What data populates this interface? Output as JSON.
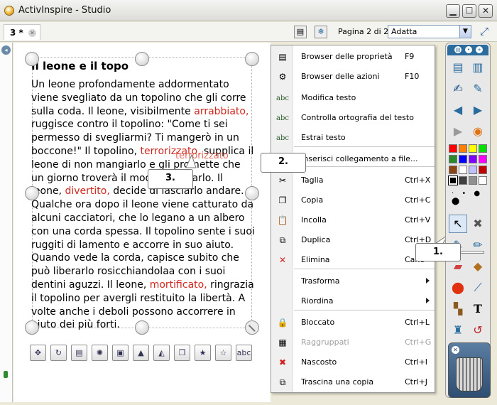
{
  "window": {
    "title": "ActivInspire - Studio"
  },
  "tabs": [
    {
      "label": "3 *"
    }
  ],
  "toolbar": {
    "page_label": "Pagina 2 di 2",
    "zoom_value": "Adatta"
  },
  "flipchart": {
    "title": "Il leone e il topo",
    "story": [
      {
        "text": "Un leone profondamente addormentato viene svegliato da un topolino che gli corre sulla coda. Il leone, visibilmente ",
        "color": ""
      },
      {
        "text": "arrabbiato,",
        "color": "red"
      },
      {
        "text": " ruggisce contro il topolino: \"Come ti sei permesso di svegliarmi? Ti mangerò in un boccone!\" Il topolino, ",
        "color": ""
      },
      {
        "text": "terrorizzato,",
        "color": "red"
      },
      {
        "text": " supplica il leone di non mangiarlo e gli promette che un giorno troverà il modo di aiutarlo. Il leone, ",
        "color": ""
      },
      {
        "text": "divertito,",
        "color": "red"
      },
      {
        "text": " decide di lasciarlo andare. Qualche ora dopo il leone viene catturato da alcuni cacciatori, che lo legano a un albero con una corda spessa. Il topolino sente i suoi ruggiti di lamento e accorre in suo aiuto. Quando vede la corda, capisce subito che può liberarlo rosicchiandolaa con i suoi dentini aguzzi. Il leone, ",
        "color": ""
      },
      {
        "text": "mortificato,",
        "color": "red"
      },
      {
        "text": " ringrazia il topolino per avergli restituito la libertà. A volte anche i deboli possono accorrere in aiuto dei più forti.",
        "color": ""
      }
    ],
    "drag_ghost_text": "terrorizzato"
  },
  "callouts": {
    "one": "1.",
    "two": "2.",
    "three": "3."
  },
  "context_menu": {
    "items": [
      {
        "label": "Browser delle proprietà",
        "shortcut": "F9",
        "icon": "properties-browser-icon",
        "glyph": "▤",
        "disabled": false
      },
      {
        "label": "Browser delle azioni",
        "shortcut": "F10",
        "icon": "actions-browser-icon",
        "glyph": "⚙",
        "disabled": false
      },
      {
        "label": "Modifica testo",
        "shortcut": "",
        "icon": "edit-text-icon",
        "glyph": "abc",
        "disabled": false
      },
      {
        "label": "Controlla ortografia del testo",
        "shortcut": "",
        "icon": "spellcheck-icon",
        "glyph": "abc",
        "disabled": false
      },
      {
        "label": "Estrai testo",
        "shortcut": "",
        "icon": "extract-text-icon",
        "glyph": "abc",
        "disabled": false
      },
      {
        "label": "Inserisci collegamento a file...",
        "shortcut": "",
        "icon": "insert-link-icon",
        "glyph": "🔗",
        "disabled": false
      },
      {
        "label": "Taglia",
        "shortcut": "Ctrl+X",
        "icon": "cut-icon",
        "glyph": "✂",
        "disabled": false
      },
      {
        "label": "Copia",
        "shortcut": "Ctrl+C",
        "icon": "copy-icon",
        "glyph": "❐",
        "disabled": false
      },
      {
        "label": "Incolla",
        "shortcut": "Ctrl+V",
        "icon": "paste-icon",
        "glyph": "📋",
        "disabled": false
      },
      {
        "label": "Duplica",
        "shortcut": "Ctrl+D",
        "icon": "duplicate-icon",
        "glyph": "⧉",
        "disabled": false
      },
      {
        "label": "Elimina",
        "shortcut": "Canc",
        "icon": "delete-icon",
        "glyph": "✕",
        "disabled": false
      },
      {
        "label": "Trasforma",
        "shortcut": "",
        "icon": "",
        "glyph": "",
        "disabled": false,
        "submenu": true
      },
      {
        "label": "Riordina",
        "shortcut": "",
        "icon": "",
        "glyph": "",
        "disabled": false,
        "submenu": true
      },
      {
        "label": "Bloccato",
        "shortcut": "Ctrl+L",
        "icon": "lock-icon",
        "glyph": "🔒",
        "disabled": false
      },
      {
        "label": "Raggruppati",
        "shortcut": "Ctrl+G",
        "icon": "group-icon",
        "glyph": "▦",
        "disabled": true
      },
      {
        "label": "Nascosto",
        "shortcut": "Ctrl+I",
        "icon": "hidden-icon",
        "glyph": "✖",
        "disabled": false
      },
      {
        "label": "Trascina una copia",
        "shortcut": "Ctrl+J",
        "icon": "drag-copy-icon",
        "glyph": "⧉",
        "disabled": false
      }
    ]
  },
  "colors": {
    "accent_red": "#d0281e",
    "palette": [
      "#ff0000",
      "#ff8000",
      "#ffff00",
      "#00c000",
      "#00ff00",
      "#0000ff",
      "#8000ff",
      "#ff00ff",
      "#8b4513",
      "#ffffff",
      "#c0c0ff",
      "#c00000",
      "#000000",
      "#404040",
      "#808080",
      "#ffffff"
    ]
  }
}
